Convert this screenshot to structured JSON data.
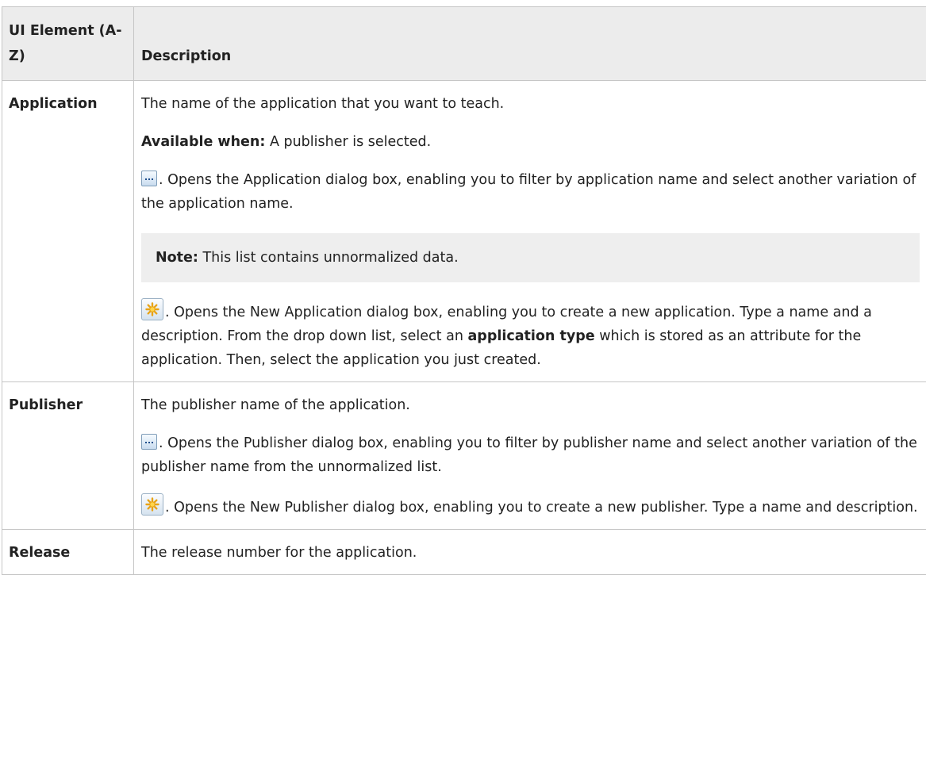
{
  "table": {
    "headers": {
      "col1": "UI Element (A-Z)",
      "col2": "Description"
    },
    "rows": [
      {
        "element": "Application",
        "line1": "The name of the application that you want to teach.",
        "available_label": "Available when:",
        "available_text": " A publisher is selected.",
        "browse_text": ". Opens the Application dialog box, enabling you to filter by application name and select another variation of the application name.",
        "note_label": "Note:",
        "note_text": " This list contains unnormalized data.",
        "new_text_before": ". Opens the New Application dialog box, enabling you to create a new application. Type a name and a description. From the drop down list, select an ",
        "new_text_bold": "application type",
        "new_text_after": " which is stored as an attribute for the application. Then, select the application you just created."
      },
      {
        "element": "Publisher",
        "line1": "The publisher name of the application.",
        "browse_text": ". Opens the Publisher dialog box, enabling you to filter by publisher name and select another variation of the publisher name from the unnormalized list.",
        "new_text": ". Opens the New Publisher dialog box, enabling you to create a new publisher. Type a name and description."
      },
      {
        "element": "Release",
        "line1": "The release number for the application."
      }
    ]
  },
  "icons": {
    "browse": "browse-ellipsis-icon",
    "new": "new-item-star-icon"
  },
  "colors": {
    "header_bg": "#ececec",
    "note_bg": "#eeeeee",
    "border": "#c6c6c6",
    "text": "#222222"
  }
}
